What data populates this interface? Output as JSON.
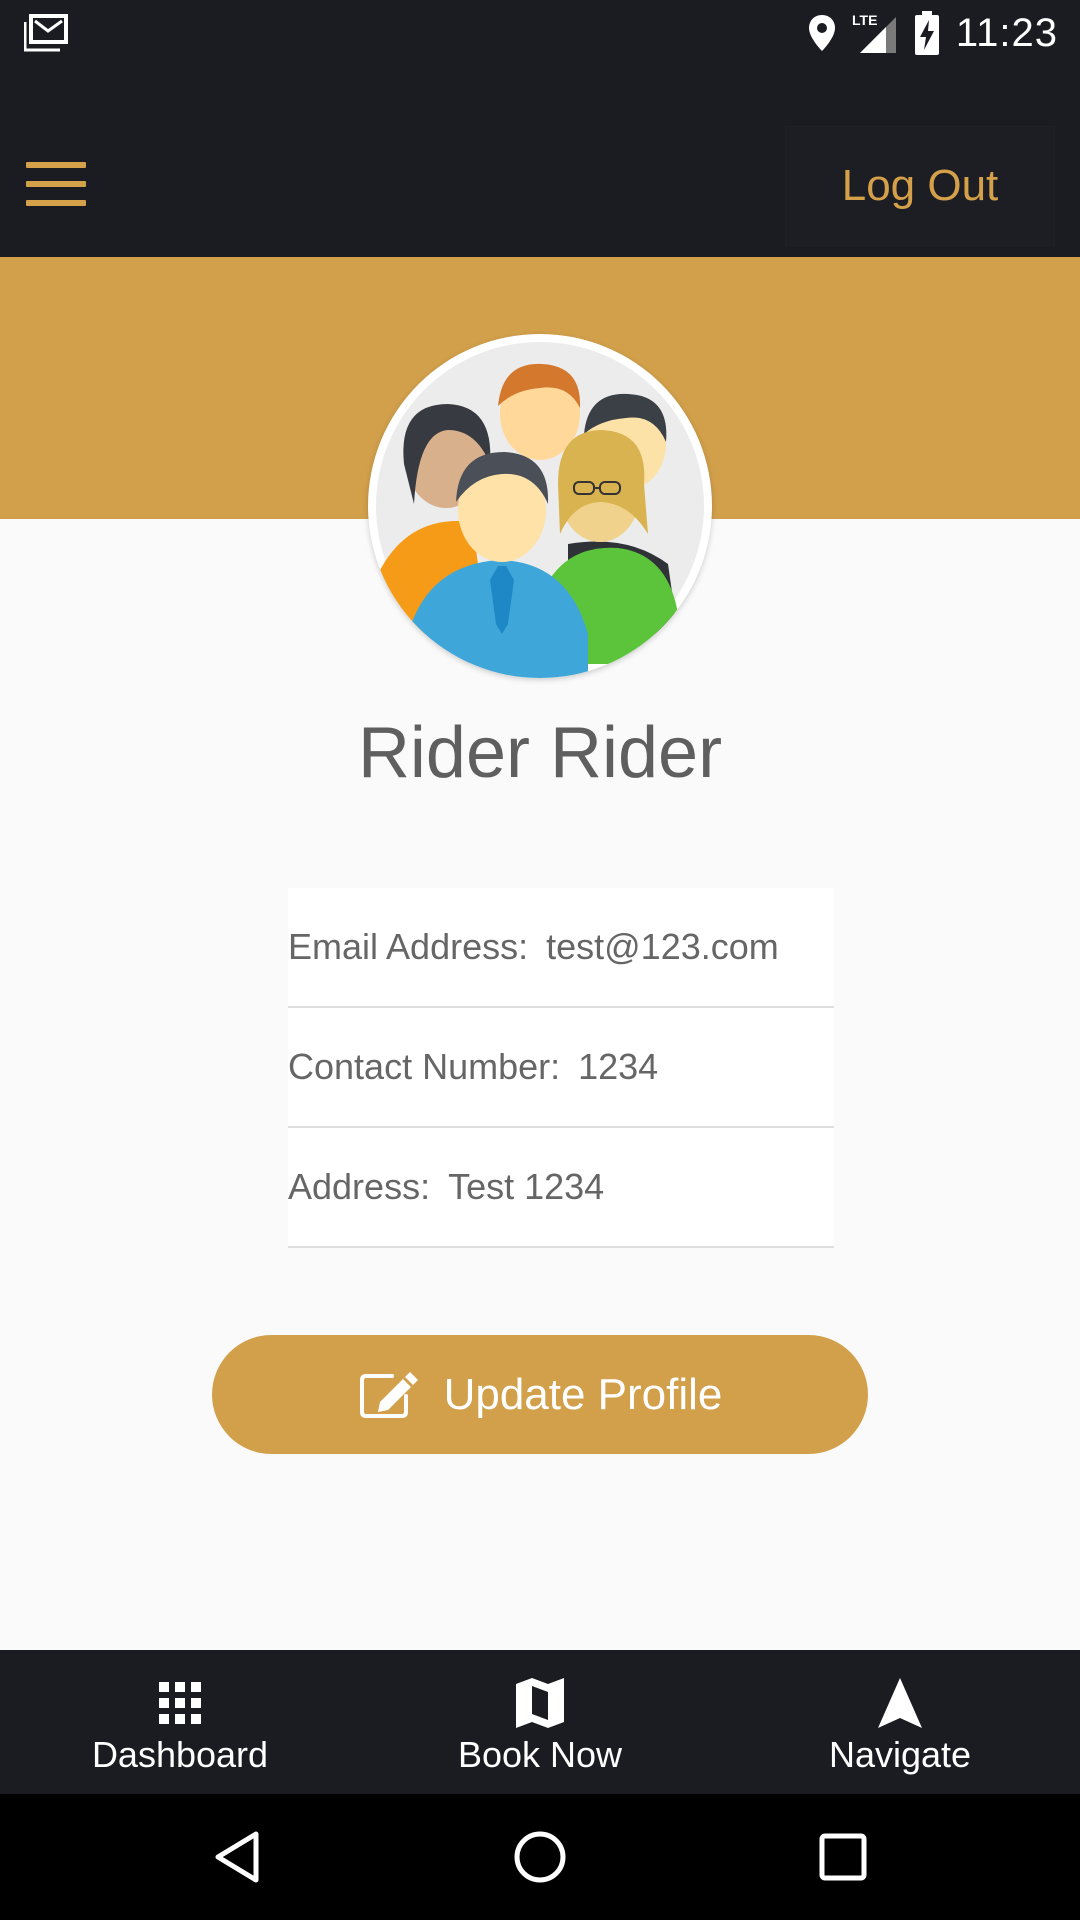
{
  "status_bar": {
    "time": "11:23",
    "network": "LTE",
    "icons": [
      "gmail-icon",
      "location-icon",
      "lte-signal-icon",
      "battery-charging-icon"
    ]
  },
  "app_bar": {
    "menu_icon": "hamburger-menu-icon",
    "logout_label": "Log Out"
  },
  "profile": {
    "avatar_icon": "group-users-avatar",
    "name": "Rider Rider",
    "fields": [
      {
        "label": "Email Address:",
        "value": "test@123.com"
      },
      {
        "label": "Contact Number:",
        "value": "1234"
      },
      {
        "label": "Address:",
        "value": "Test 1234"
      }
    ],
    "update_button_label": "Update Profile",
    "update_button_icon": "edit-icon"
  },
  "bottom_nav": [
    {
      "label": "Dashboard",
      "icon": "grid-icon"
    },
    {
      "label": "Book Now",
      "icon": "map-icon"
    },
    {
      "label": "Navigate",
      "icon": "navigation-arrow-icon"
    }
  ],
  "system_nav": [
    "back-icon",
    "home-icon",
    "recents-icon"
  ],
  "colors": {
    "accent": "#d2a04b",
    "dark_bar": "#1b1b22",
    "background": "#fafafa",
    "text_gray": "#666666"
  }
}
